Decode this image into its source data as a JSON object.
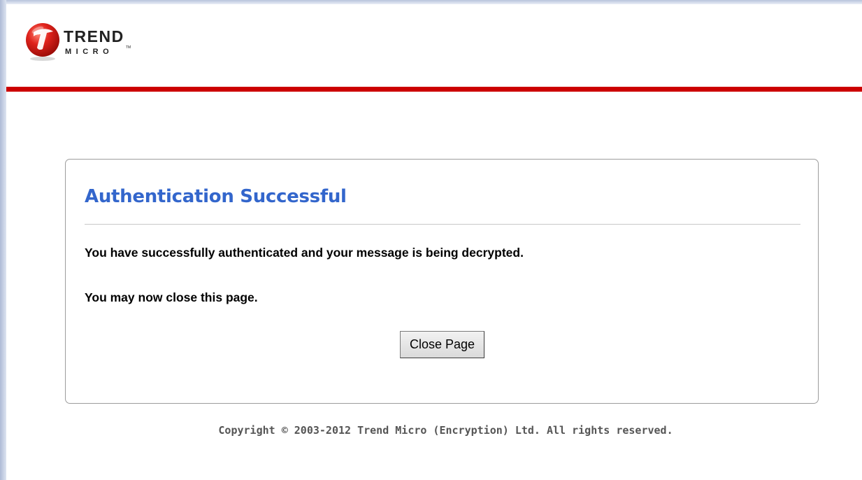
{
  "header": {
    "logo": {
      "icon": "trend-micro-logo-icon",
      "wordmark_top": "TREND",
      "wordmark_bottom": "MICRO",
      "trademark": "TM"
    },
    "accent_color": "#cc0000"
  },
  "panel": {
    "title": "Authentication Successful",
    "title_color": "#3366cc",
    "message_1": "You have successfully authenticated and your message is being decrypted.",
    "message_2": "You may now close this page.",
    "close_button_label": "Close Page"
  },
  "footer": {
    "copyright": "Copyright © 2003-2012 Trend Micro (Encryption) Ltd. All rights reserved."
  }
}
